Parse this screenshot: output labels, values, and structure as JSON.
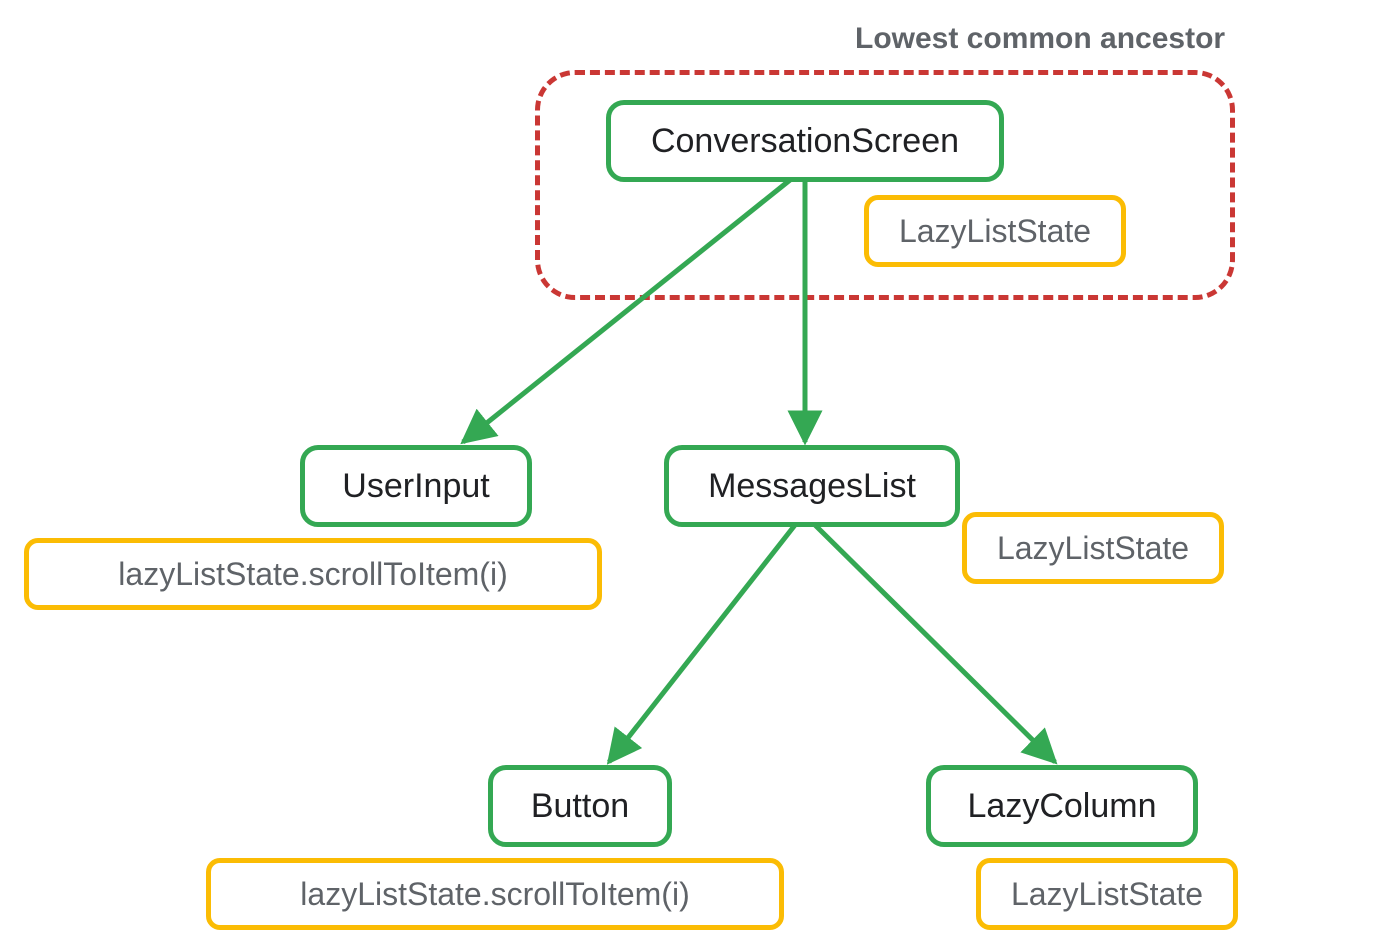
{
  "annotation": {
    "label": "Lowest common ancestor"
  },
  "nodes": {
    "root": "ConversationScreen",
    "user_input": "UserInput",
    "messages_list": "MessagesList",
    "button": "Button",
    "lazy_column": "LazyColumn"
  },
  "tags": {
    "root_state": "LazyListState",
    "user_input_call": "lazyListState.scrollToItem(i)",
    "messages_state": "LazyListState",
    "button_call": "lazyListState.scrollToItem(i)",
    "lazy_column_state": "LazyListState"
  },
  "colors": {
    "node_border": "#34a853",
    "tag_border": "#fbbc04",
    "dashed_border": "#c5221f",
    "text_primary": "#202124",
    "text_secondary": "#5f6368",
    "edge": "#34a853"
  }
}
